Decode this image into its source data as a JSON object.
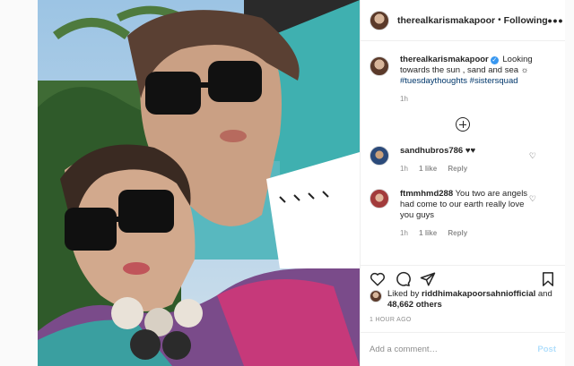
{
  "post": {
    "username": "therealkarismakapoor",
    "separator": "•",
    "follow_label": "Following",
    "more_label": "•••"
  },
  "caption": {
    "username": "therealkarismakapoor",
    "verified_mark": "✓",
    "text": "Looking towards the sun , sand and sea",
    "sun_emoji": "☼",
    "hashtags": [
      "#tuesdaythoughts",
      "#sistersquad"
    ],
    "age": "1h"
  },
  "comments": [
    {
      "username": "sandhubros786",
      "text": "♥♥",
      "age": "1h",
      "likes": "1 like",
      "reply": "Reply"
    },
    {
      "username": "ftmmhmd288",
      "text": "You two are angels had come to our earth really love you guys",
      "age": "1h",
      "likes": "1 like",
      "reply": "Reply"
    }
  ],
  "likes": {
    "prefix": "Liked by",
    "user": "riddhimakapoorsahniofficial",
    "and": "and",
    "count": "48,662 others"
  },
  "timestamp": "1 HOUR AGO",
  "add_comment": {
    "placeholder": "Add a comment…",
    "post_label": "Post"
  },
  "icons": {
    "like": "heart-icon",
    "comment": "comment-icon",
    "share": "share-icon",
    "save": "bookmark-icon",
    "load_more": "plus-circle-icon"
  },
  "colors": {
    "link": "#00376b",
    "verified": "#3897f0",
    "post_disabled": "#b2dffc",
    "muted": "#8e8e8e"
  }
}
